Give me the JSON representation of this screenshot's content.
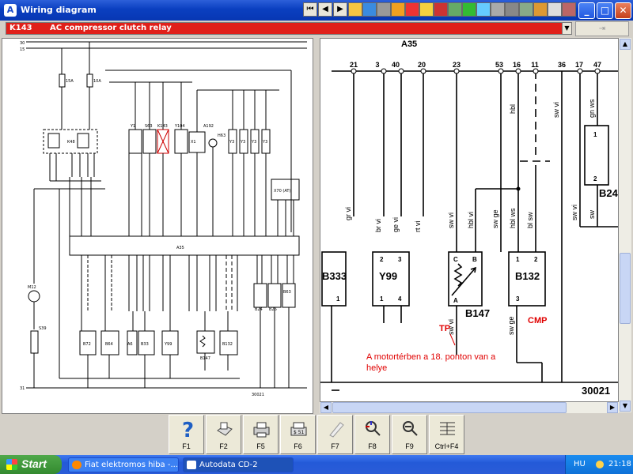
{
  "window": {
    "title": "Wiring diagram",
    "icon": "autodata-app-icon"
  },
  "toolbar": {
    "icons": [
      "nav-first",
      "nav-prev",
      "nav-next",
      "yellow-envelope",
      "globe",
      "tools",
      "folder",
      "document",
      "car",
      "engine",
      "flag",
      "ladybug",
      "green-card",
      "cd",
      "notes",
      "gauge",
      "parts",
      "house",
      "crate"
    ]
  },
  "selector": {
    "code": "K143",
    "label": "AC compressor clutch relay",
    "button_icon": "exit-icon"
  },
  "left_diagram": {
    "top_rail_labels": [
      "30",
      "15"
    ],
    "bottom_rail_label": "31",
    "module_label": "A35",
    "bottom_code": "30021",
    "relay": "K48",
    "parts_top": [
      "Y1",
      "S63",
      "K143",
      "Y104",
      "X1",
      "A192",
      "H63",
      "Y3",
      "Y3",
      "Y3",
      "Y3"
    ],
    "parts_bottom": [
      "B72",
      "B64",
      "A6",
      "B33",
      "Y99",
      "B147",
      "B132",
      "B24",
      "B26",
      "B63"
    ],
    "side_parts": [
      "M12",
      "S39"
    ],
    "x_box": "X70 (AT)",
    "fuses": [
      "15A",
      "10A"
    ]
  },
  "right_diagram": {
    "module_label": "A35",
    "pin_numbers": [
      "21",
      "3",
      "40",
      "20",
      "23",
      "53",
      "16",
      "11",
      "36",
      "17",
      "47"
    ],
    "wire_labels": {
      "grvi": "gr vi",
      "brvi": "br vi",
      "gevi": "ge vi",
      "rtvi": "rt vi",
      "swvi_a": "sw vi",
      "hblvi": "hbl vi",
      "swge": "sw ge",
      "hblws": "hbl ws",
      "blsw": "bl sw",
      "swvi_b": "sw vi",
      "gnws": "gn ws",
      "hbl": "hbl",
      "swvi_top": "sw vi",
      "sw": "sw",
      "swvi_b147": "sw vi",
      "swge_b132": "sw ge"
    },
    "components": {
      "b333": {
        "label": "B333",
        "pin": "1"
      },
      "y99": {
        "label": "Y99",
        "pins": [
          "2",
          "3",
          "1",
          "4"
        ]
      },
      "b147": {
        "label": "B147",
        "pins": [
          "C",
          "B",
          "A"
        ]
      },
      "b132": {
        "label": "B132",
        "pins": [
          "1",
          "2",
          "3"
        ]
      },
      "b24": {
        "label": "B24",
        "pins": [
          "1",
          "2"
        ]
      }
    },
    "annotation_tp": "TP",
    "annotation_cmp": "CMP",
    "annotation_text_1": "A motortérben a 18. ponton van  a",
    "annotation_text_2": "helye",
    "bottom_code": "30021",
    "colors": {
      "annotation": "#e00000"
    }
  },
  "fkeys": [
    {
      "label": "F1",
      "icon": "help-icon"
    },
    {
      "label": "F2",
      "icon": "print-setup-icon"
    },
    {
      "label": "F5",
      "icon": "printer-icon"
    },
    {
      "label": "F6",
      "icon": "export-icon"
    },
    {
      "label": "F7",
      "icon": "marker-icon"
    },
    {
      "label": "F8",
      "icon": "zoom-in-icon"
    },
    {
      "label": "F9",
      "icon": "zoom-out-icon"
    },
    {
      "label": "Ctrl+F4",
      "icon": "grid-icon"
    }
  ],
  "taskbar": {
    "start": "Start",
    "tasks": [
      {
        "label": "Fiat elektromos hiba -...",
        "icon": "firefox-icon"
      },
      {
        "label": "Autodata CD-2",
        "icon": "autodata-icon"
      }
    ],
    "lang": "HU",
    "time": "21:18"
  }
}
